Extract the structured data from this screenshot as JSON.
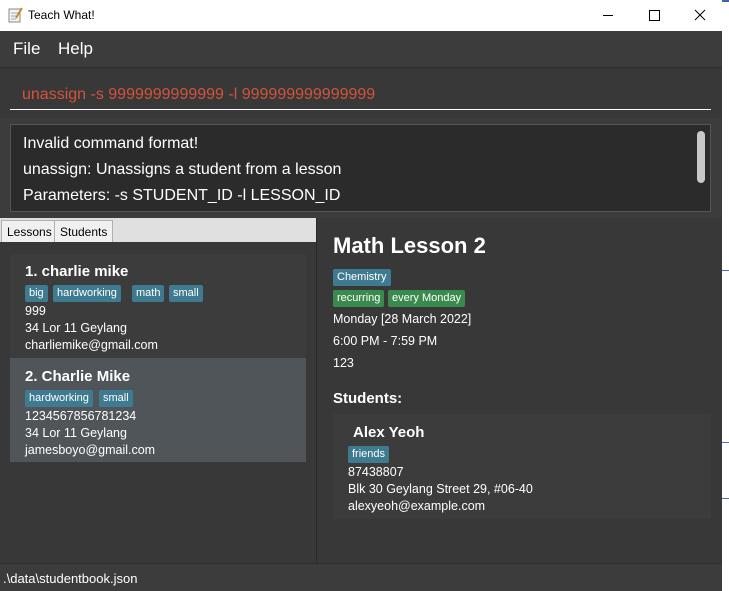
{
  "window": {
    "title": "Teach What!"
  },
  "menu": {
    "file": "File",
    "help": "Help"
  },
  "command": {
    "value": "unassign -s 9999999999999 -l 999999999999999"
  },
  "result": {
    "lines": [
      "Invalid command format!",
      "unassign: Unassigns a student from a lesson",
      "Parameters: -s STUDENT_ID -l LESSON_ID"
    ]
  },
  "tabs": {
    "lessons": "Lessons",
    "students": "Students"
  },
  "student_list": [
    {
      "title": "1.  charlie mike",
      "tags": [
        "big",
        "hardworking",
        "math",
        "small"
      ],
      "phone": "999",
      "address": "34 Lor 11 Geylang",
      "email": "charliemike@gmail.com"
    },
    {
      "title": "2.  Charlie Mike",
      "tags": [
        "hardworking",
        "small"
      ],
      "phone": "1234567856781234",
      "address": "34 Lor 11 Geylang",
      "email": "jamesboyo@gmail.com"
    }
  ],
  "lesson_detail": {
    "title": "Math Lesson 2",
    "subject_tag": "Chemistry",
    "recurring_tags": [
      "recurring",
      "every Monday"
    ],
    "date": "Monday [28 March 2022]",
    "time": "6:00 PM - 7:59 PM",
    "id": "123",
    "students_heading": "Students:",
    "student": {
      "name": "Alex Yeoh",
      "tag": "friends",
      "phone": "87438807",
      "address": "Blk 30 Geylang Street 29, #06-40",
      "email": "alexyeoh@example.com"
    }
  },
  "status": {
    "path": ".\\data\\studentbook.json"
  },
  "colors": {
    "accent_tag": "#3e7b91",
    "green_tag": "#3a8a4e",
    "command_error": "#d2533c",
    "background": "#3c3c3c"
  },
  "icons": [
    "notepad-icon",
    "minimize-icon",
    "maximize-icon",
    "close-icon"
  ]
}
